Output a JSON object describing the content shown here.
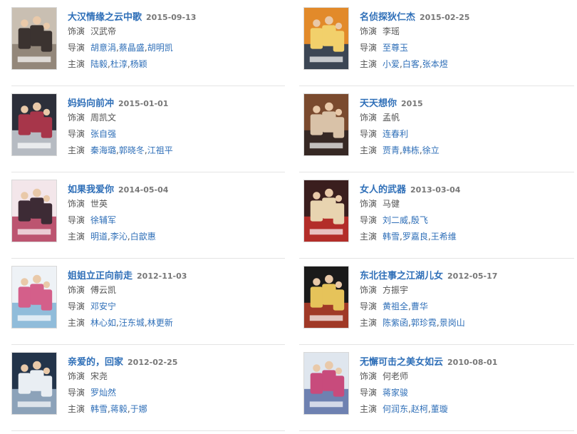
{
  "labels": {
    "role": "饰演",
    "director": "导演",
    "cast": "主演"
  },
  "separator": ",",
  "items": [
    {
      "title": "大汉情缘之云中歌",
      "date": "2015-09-13",
      "role": "汉武帝",
      "directors": [
        "胡意涓",
        "蔡晶盛",
        "胡明凯"
      ],
      "cast": [
        "陆毅",
        "杜淳",
        "杨颖"
      ],
      "poster_colors": [
        "#c9bfb2",
        "#8a7d70",
        "#3b3330"
      ]
    },
    {
      "title": "名侦探狄仁杰",
      "date": "2015-02-25",
      "role": "李瑶",
      "directors": [
        "至尊玉"
      ],
      "cast": [
        "小爱",
        "白客",
        "张本煜"
      ],
      "poster_colors": [
        "#e28a2a",
        "#1f3a5c",
        "#f2d06b"
      ]
    },
    {
      "title": "妈妈向前冲",
      "date": "2015-01-01",
      "role": "周凯文",
      "directors": [
        "张自强"
      ],
      "cast": [
        "秦海璐",
        "郭晓冬",
        "江祖平"
      ],
      "poster_colors": [
        "#2c2f3a",
        "#cfd3da",
        "#a7364a"
      ]
    },
    {
      "title": "天天想你",
      "date": "2015",
      "role": "孟帆",
      "directors": [
        "连春利"
      ],
      "cast": [
        "贾青",
        "韩栋",
        "徐立"
      ],
      "poster_colors": [
        "#7a4a2e",
        "#2a2222",
        "#d9c2a8"
      ]
    },
    {
      "title": "如果我爱你",
      "date": "2014-05-04",
      "role": "世英",
      "directors": [
        "徐辅军"
      ],
      "cast": [
        "明道",
        "李沁",
        "白歆惠"
      ],
      "poster_colors": [
        "#f3e6ea",
        "#b23a5a",
        "#3d2b35"
      ]
    },
    {
      "title": "女人的武器",
      "date": "2013-03-04",
      "role": "马健",
      "directors": [
        "刘二威",
        "殷飞"
      ],
      "cast": [
        "韩雪",
        "罗嘉良",
        "王希维"
      ],
      "poster_colors": [
        "#3a1e1e",
        "#c9302c",
        "#e8d4b0"
      ]
    },
    {
      "title": "姐姐立正向前走",
      "date": "2012-11-03",
      "role": "傅云凯",
      "directors": [
        "邓安宁"
      ],
      "cast": [
        "林心如",
        "汪东城",
        "林更新"
      ],
      "poster_colors": [
        "#eef2f6",
        "#7fb3d5",
        "#d45f8a"
      ]
    },
    {
      "title": "东北往事之江湖儿女",
      "date": "2012-05-17",
      "role": "方振宇",
      "directors": [
        "黄祖全",
        "曹华"
      ],
      "cast": [
        "陈紫函",
        "郭珍霓",
        "景岗山"
      ],
      "poster_colors": [
        "#1a1a1a",
        "#b8402a",
        "#e6c35a"
      ]
    },
    {
      "title": "亲爱的，回家",
      "date": "2012-02-25",
      "role": "宋尧",
      "directors": [
        "罗灿然"
      ],
      "cast": [
        "韩雪",
        "蒋毅",
        "于娜"
      ],
      "poster_colors": [
        "#23344a",
        "#9fb6cc",
        "#e9eef3"
      ]
    },
    {
      "title": "无懈可击之美女如云",
      "date": "2010-08-01",
      "role": "何老师",
      "directors": [
        "蒋家骏"
      ],
      "cast": [
        "何润东",
        "赵柯",
        "董璇"
      ],
      "poster_colors": [
        "#dfe6ee",
        "#5b6fa6",
        "#c84b7c"
      ]
    }
  ]
}
